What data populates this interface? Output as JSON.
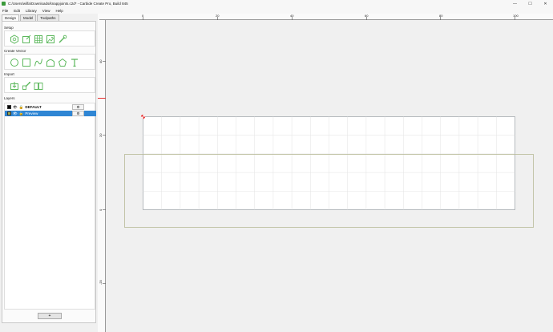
{
  "window": {
    "title": "C:/Users/wilfa/Downloads/knappjoints.c2d* - Carbide Create Pro, Build 845",
    "minimize": "—",
    "maximize": "☐",
    "close": "✕"
  },
  "menu": [
    "File",
    "Edit",
    "Library",
    "View",
    "Help"
  ],
  "tabs": [
    "Design",
    "Model",
    "Toolpaths"
  ],
  "sections": {
    "setup": "Setup",
    "create_vector": "Create Vector",
    "import": "Import",
    "layers": "Layers"
  },
  "layers": [
    {
      "name": "DEFAULT",
      "color": "#000000",
      "selected": false
    },
    {
      "name": "Preview",
      "color": "#9aa34a",
      "selected": true
    }
  ],
  "layer_gear": "⚙",
  "add_layer": "+",
  "ruler_top": [
    "0",
    "20",
    "40",
    "60",
    "80",
    "100"
  ],
  "ruler_left": [
    "40",
    "20",
    "0",
    "-20"
  ],
  "colors": {
    "accent": "#2f86d4",
    "icon_green": "#5cb85c",
    "stock_border": "#9aa0a6",
    "preview_border": "#b7b996",
    "origin_marker": "#e53030"
  }
}
